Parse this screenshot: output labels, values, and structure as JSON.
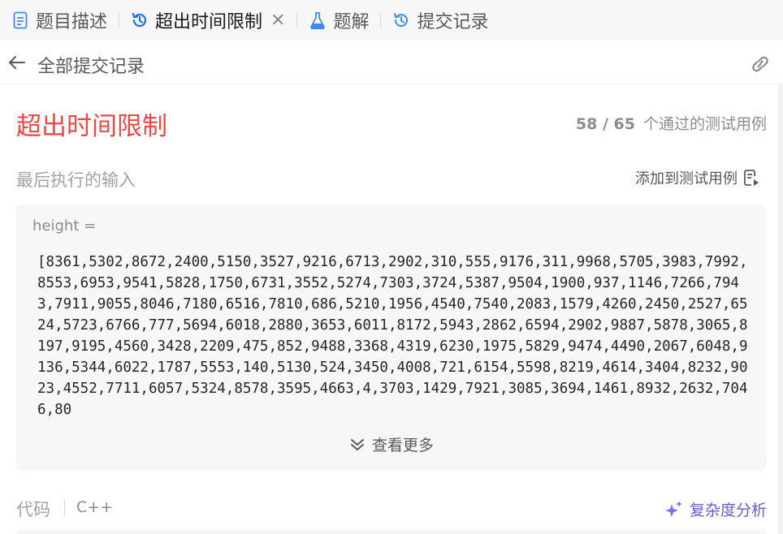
{
  "tabs": [
    {
      "label": "题目描述",
      "icon": "document-icon",
      "active": false
    },
    {
      "label": "超出时间限制",
      "icon": "history-icon",
      "active": true,
      "closable": true
    },
    {
      "label": "题解",
      "icon": "flask-icon",
      "active": false
    },
    {
      "label": "提交记录",
      "icon": "history-icon",
      "active": false
    }
  ],
  "subheader": {
    "title": "全部提交记录"
  },
  "result": {
    "status": "超出时间限制",
    "status_color": "#ef4743",
    "passed": "58",
    "total": "65",
    "passed_text": "58 / 65",
    "passed_suffix": "个通过的测试用例"
  },
  "last_input": {
    "label": "最后执行的输入",
    "add_testcase": "添加到测试用例",
    "var_name": "height =",
    "value": "[8361,5302,8672,2400,5150,3527,9216,6713,2902,310,555,9176,311,9968,5705,3983,7992,8553,6953,9541,5828,1750,6731,3552,5274,7303,3724,5387,9504,1900,937,1146,7266,7943,7911,9055,8046,7180,6516,7810,686,5210,1956,4540,7540,2083,1579,4260,2450,2527,6524,5723,6766,777,5694,6018,2880,3653,6011,8172,5943,2862,6594,2902,9887,5878,3065,8197,9195,4560,3428,2209,475,852,9488,3368,4319,6230,1975,5829,9474,4490,2067,6048,9136,5344,6022,1787,5553,140,5130,524,3450,4008,721,6154,5598,8219,4614,3404,8232,9023,4552,7711,6057,5324,8578,3595,4663,4,3703,1429,7921,3085,3694,1461,8932,2632,7046,80",
    "see_more": "查看更多"
  },
  "code": {
    "label": "代码",
    "language": "C++",
    "complexity_label": "复杂度分析",
    "complexity_color": "#6a5acd"
  }
}
